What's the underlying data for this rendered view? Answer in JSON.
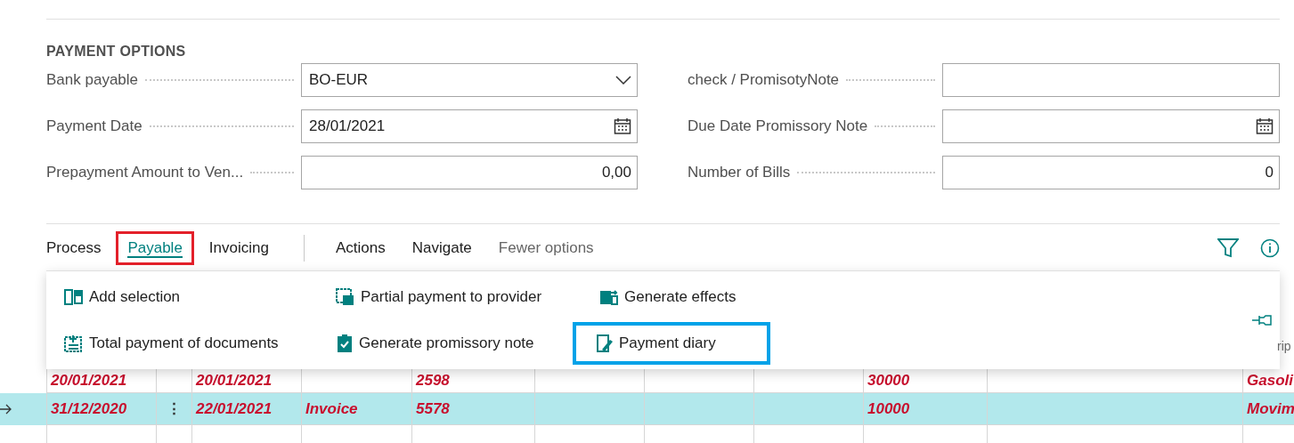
{
  "section": {
    "title": "PAYMENT OPTIONS"
  },
  "fields": [
    {
      "label": "Bank payable",
      "kind": "dropdown",
      "value": "BO-EUR"
    },
    {
      "label": "check / PromisotyNote",
      "kind": "text"
    },
    {
      "label": "Payment Date",
      "kind": "date",
      "value": "28/01/2021"
    },
    {
      "label": "Due Date Promissory Note",
      "kind": "date"
    },
    {
      "label": "Prepayment Amount to Ven...",
      "kind": "number",
      "value": "0,00"
    },
    {
      "label": "Number of Bills",
      "kind": "number",
      "value": "0"
    }
  ],
  "tabs": [
    {
      "label": "Process",
      "kind": "tab",
      "selected": false,
      "highlighted": false
    },
    {
      "label": "Payable",
      "kind": "tab",
      "selected": true,
      "highlighted": true
    },
    {
      "label": "Invoicing",
      "kind": "tab",
      "selected": false,
      "highlighted": false
    },
    {
      "kind": "divider"
    },
    {
      "label": "Actions",
      "kind": "tab",
      "selected": false,
      "highlighted": false
    },
    {
      "label": "Navigate",
      "kind": "tab",
      "selected": false,
      "highlighted": false
    },
    {
      "label": "Fewer options",
      "kind": "toggle",
      "selected": false,
      "highlighted": false
    }
  ],
  "actions": [
    {
      "label": "Add selection",
      "highlighted": false
    },
    {
      "label": "Partial payment to provider",
      "highlighted": false
    },
    {
      "label": "Generate effects",
      "highlighted": false
    },
    {
      "label": "Total payment of documents",
      "highlighted": false
    },
    {
      "label": "Generate promissory note",
      "highlighted": false
    },
    {
      "label": "Payment diary",
      "highlighted": true
    }
  ],
  "table": {
    "header_fragment": "rip",
    "rows": [
      {
        "selected": false,
        "cells": [
          "20/01/2021",
          "",
          "20/01/2021",
          "",
          "2598",
          "",
          "",
          "",
          "30000",
          "",
          "Gasoli"
        ]
      },
      {
        "selected": true,
        "cells": [
          "31/12/2020",
          "⋮",
          "22/01/2021",
          "Invoice",
          "5578",
          "",
          "",
          "",
          "10000",
          "",
          "Movim"
        ]
      }
    ]
  }
}
